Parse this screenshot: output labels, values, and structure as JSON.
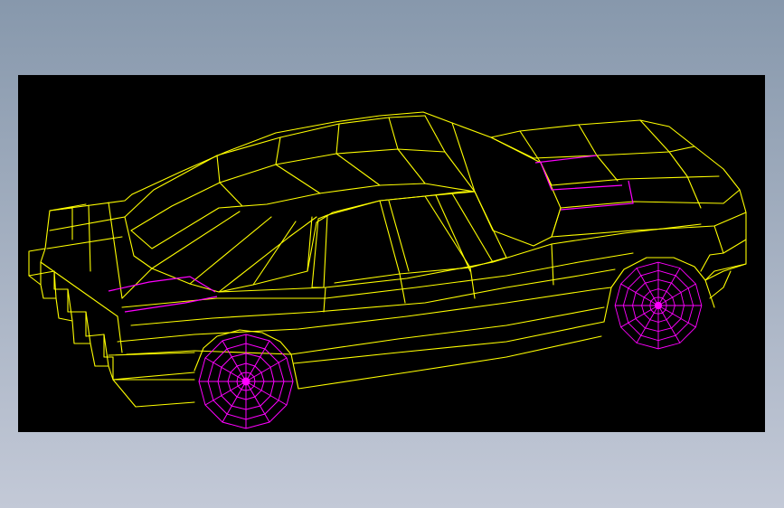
{
  "viewer": {
    "background": "#000000",
    "backdrop_top": "#8798ac",
    "backdrop_bottom": "#c3c9d7"
  },
  "model": {
    "subject": "car-wireframe",
    "body_color": "#ffff00",
    "accent_color": "#ff00ff",
    "wheel_color": "#ff00ff",
    "wheel_count": 2
  }
}
